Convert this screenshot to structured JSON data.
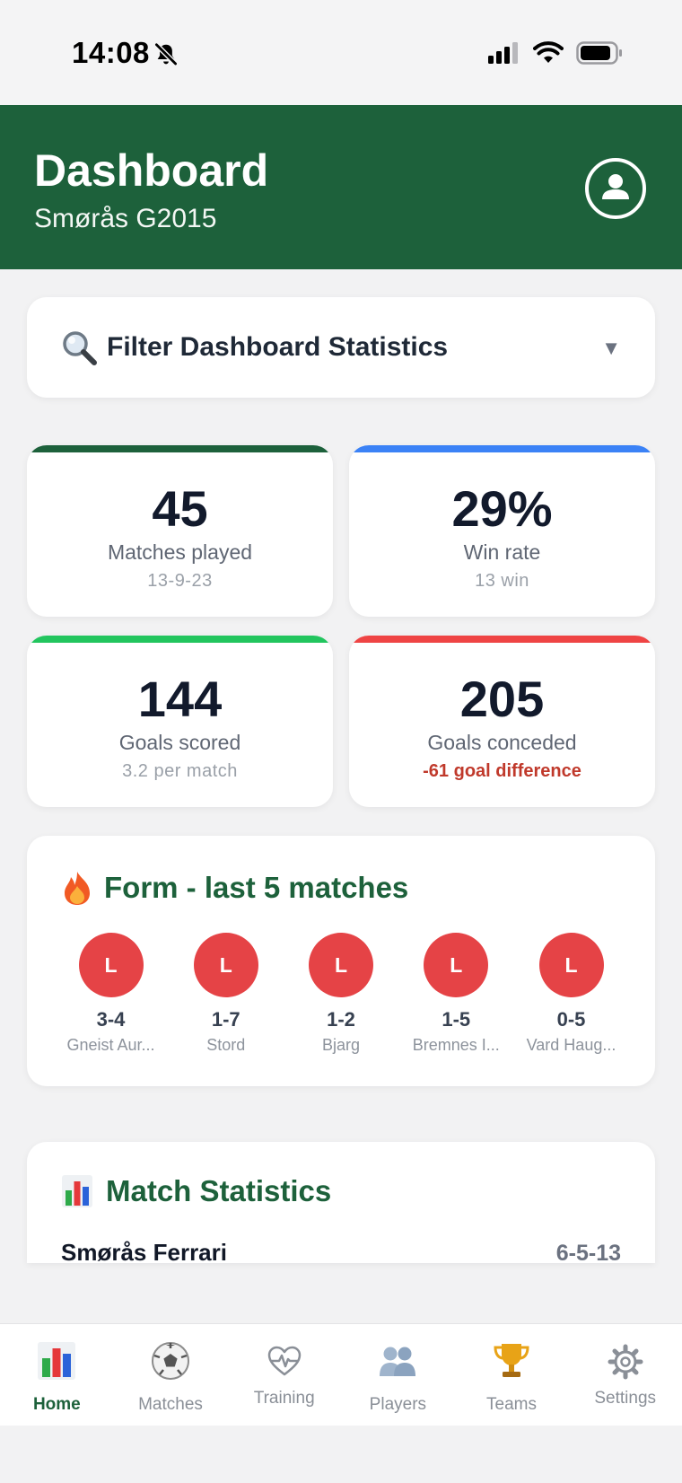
{
  "status_bar": {
    "time": "14:08"
  },
  "header": {
    "title": "Dashboard",
    "subtitle": "Smørås G2015"
  },
  "filter": {
    "label": "Filter Dashboard Statistics",
    "caret": "▼"
  },
  "stats": [
    {
      "value": "45",
      "label": "Matches played",
      "sub": "13-9-23",
      "color": "#1d613b"
    },
    {
      "value": "29%",
      "label": "Win rate",
      "sub": "13 win",
      "color": "#3b82f6"
    },
    {
      "value": "144",
      "label": "Goals scored",
      "sub": "3.2 per match",
      "color": "#22c55e"
    },
    {
      "value": "205",
      "label": "Goals conceded",
      "sub": "-61 goal difference",
      "color": "#ef4444"
    }
  ],
  "form": {
    "title": "Form - last 5 matches",
    "matches": [
      {
        "result": "L",
        "score": "3-4",
        "opponent": "Gneist Aur..."
      },
      {
        "result": "L",
        "score": "1-7",
        "opponent": "Stord"
      },
      {
        "result": "L",
        "score": "1-2",
        "opponent": "Bjarg"
      },
      {
        "result": "L",
        "score": "1-5",
        "opponent": "Bremnes I..."
      },
      {
        "result": "L",
        "score": "0-5",
        "opponent": "Vard Haug..."
      }
    ]
  },
  "match_statistics": {
    "title": "Match Statistics",
    "team": "Smørås Ferrari",
    "record": "6-5-13"
  },
  "nav": {
    "items": [
      {
        "label": "Home",
        "icon": "bar-chart-icon",
        "active": true
      },
      {
        "label": "Matches",
        "icon": "soccer-ball-icon"
      },
      {
        "label": "Training",
        "icon": "heartbeat-icon"
      },
      {
        "label": "Players",
        "icon": "users-icon"
      },
      {
        "label": "Teams",
        "icon": "trophy-icon"
      },
      {
        "label": "Settings",
        "icon": "gear-icon"
      }
    ]
  }
}
